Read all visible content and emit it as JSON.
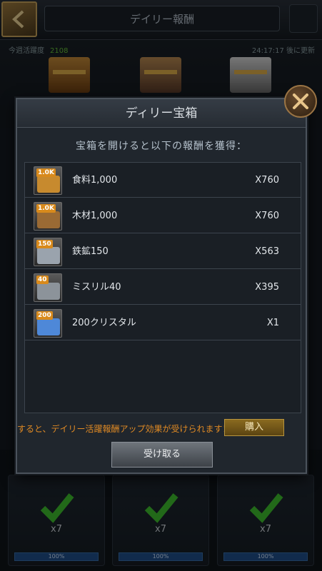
{
  "background": {
    "title": "デイリー報酬",
    "sub_left_label": "今週活躍度",
    "sub_left_value": "2108",
    "sub_right": "24:17:17 後に更新",
    "tiers": [
      {
        "count": "x7",
        "progress": "100%"
      },
      {
        "count": "x7",
        "progress": "100%"
      },
      {
        "count": "x7",
        "progress": "100%"
      }
    ]
  },
  "modal": {
    "title": "ディリー宝箱",
    "subtitle": "宝箱を開けると以下の報酬を獲得：",
    "rewards": [
      {
        "badge": "1.0K",
        "name": "食料1,000",
        "qty": "X760",
        "icon": "food-icon",
        "color": "#c78a2e"
      },
      {
        "badge": "1.0K",
        "name": "木材1,000",
        "qty": "X760",
        "icon": "wood-icon",
        "color": "#9a6a34"
      },
      {
        "badge": "150",
        "name": "鉄鉱150",
        "qty": "X563",
        "icon": "iron-icon",
        "color": "#9aa3ad"
      },
      {
        "badge": "40",
        "name": "ミスリル40",
        "qty": "X395",
        "icon": "mithril-icon",
        "color": "#8c939a"
      },
      {
        "badge": "200",
        "name": "200クリスタル",
        "qty": "X1",
        "icon": "crystal-icon",
        "color": "#4e88d8"
      }
    ],
    "vip_text": "すると、デイリー活躍報酬アップ効果が受けられます！",
    "buy_label": "購入",
    "receive_label": "受け取る"
  }
}
